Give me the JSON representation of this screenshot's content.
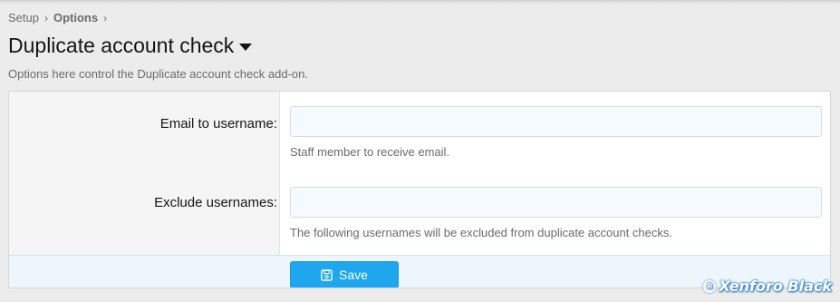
{
  "breadcrumb": {
    "items": [
      "Setup",
      "Options"
    ],
    "separator": "›"
  },
  "header": {
    "title": "Duplicate account check",
    "description": "Options here control the Duplicate account check add-on."
  },
  "form": {
    "fields": [
      {
        "label": "Email to username:",
        "value": "",
        "placeholder": "",
        "hint": "Staff member to receive email."
      },
      {
        "label": "Exclude usernames:",
        "value": "",
        "placeholder": "",
        "hint": "The following usernames will be excluded from duplicate account checks."
      }
    ],
    "save_label": "Save"
  },
  "watermark": {
    "text": "Xenforo Black",
    "mark": "R"
  },
  "colors": {
    "accent": "#1ea7ef",
    "footer_bg": "#edf6fd",
    "input_bg": "#f5faff"
  },
  "icons": {
    "dropdown": "caret-down-icon",
    "save": "floppy-disk-icon",
    "separator": "chevron-right-icon"
  }
}
